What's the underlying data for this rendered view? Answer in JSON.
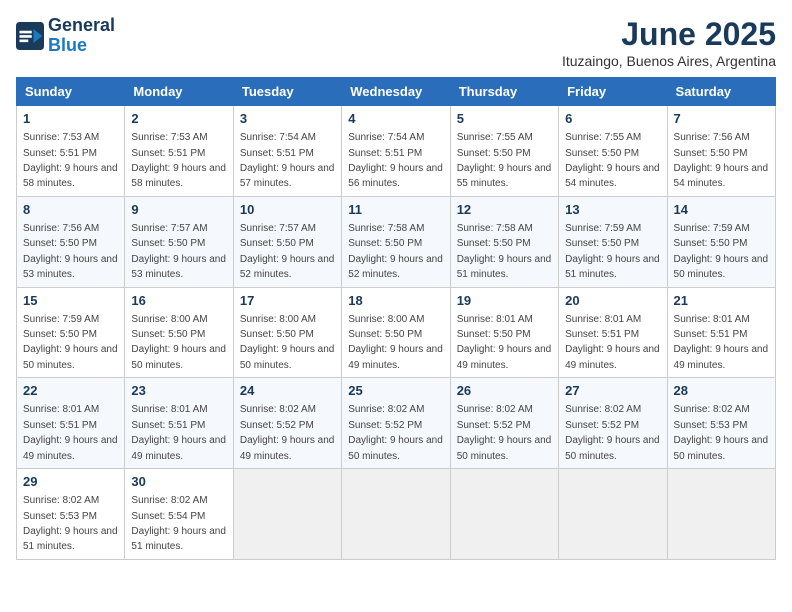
{
  "header": {
    "logo_line1": "General",
    "logo_line2": "Blue",
    "month": "June 2025",
    "location": "Ituzaingo, Buenos Aires, Argentina"
  },
  "weekdays": [
    "Sunday",
    "Monday",
    "Tuesday",
    "Wednesday",
    "Thursday",
    "Friday",
    "Saturday"
  ],
  "weeks": [
    [
      {
        "day": "1",
        "sunrise": "7:53 AM",
        "sunset": "5:51 PM",
        "daylight": "9 hours and 58 minutes."
      },
      {
        "day": "2",
        "sunrise": "7:53 AM",
        "sunset": "5:51 PM",
        "daylight": "9 hours and 58 minutes."
      },
      {
        "day": "3",
        "sunrise": "7:54 AM",
        "sunset": "5:51 PM",
        "daylight": "9 hours and 57 minutes."
      },
      {
        "day": "4",
        "sunrise": "7:54 AM",
        "sunset": "5:51 PM",
        "daylight": "9 hours and 56 minutes."
      },
      {
        "day": "5",
        "sunrise": "7:55 AM",
        "sunset": "5:50 PM",
        "daylight": "9 hours and 55 minutes."
      },
      {
        "day": "6",
        "sunrise": "7:55 AM",
        "sunset": "5:50 PM",
        "daylight": "9 hours and 54 minutes."
      },
      {
        "day": "7",
        "sunrise": "7:56 AM",
        "sunset": "5:50 PM",
        "daylight": "9 hours and 54 minutes."
      }
    ],
    [
      {
        "day": "8",
        "sunrise": "7:56 AM",
        "sunset": "5:50 PM",
        "daylight": "9 hours and 53 minutes."
      },
      {
        "day": "9",
        "sunrise": "7:57 AM",
        "sunset": "5:50 PM",
        "daylight": "9 hours and 53 minutes."
      },
      {
        "day": "10",
        "sunrise": "7:57 AM",
        "sunset": "5:50 PM",
        "daylight": "9 hours and 52 minutes."
      },
      {
        "day": "11",
        "sunrise": "7:58 AM",
        "sunset": "5:50 PM",
        "daylight": "9 hours and 52 minutes."
      },
      {
        "day": "12",
        "sunrise": "7:58 AM",
        "sunset": "5:50 PM",
        "daylight": "9 hours and 51 minutes."
      },
      {
        "day": "13",
        "sunrise": "7:59 AM",
        "sunset": "5:50 PM",
        "daylight": "9 hours and 51 minutes."
      },
      {
        "day": "14",
        "sunrise": "7:59 AM",
        "sunset": "5:50 PM",
        "daylight": "9 hours and 50 minutes."
      }
    ],
    [
      {
        "day": "15",
        "sunrise": "7:59 AM",
        "sunset": "5:50 PM",
        "daylight": "9 hours and 50 minutes."
      },
      {
        "day": "16",
        "sunrise": "8:00 AM",
        "sunset": "5:50 PM",
        "daylight": "9 hours and 50 minutes."
      },
      {
        "day": "17",
        "sunrise": "8:00 AM",
        "sunset": "5:50 PM",
        "daylight": "9 hours and 50 minutes."
      },
      {
        "day": "18",
        "sunrise": "8:00 AM",
        "sunset": "5:50 PM",
        "daylight": "9 hours and 49 minutes."
      },
      {
        "day": "19",
        "sunrise": "8:01 AM",
        "sunset": "5:50 PM",
        "daylight": "9 hours and 49 minutes."
      },
      {
        "day": "20",
        "sunrise": "8:01 AM",
        "sunset": "5:51 PM",
        "daylight": "9 hours and 49 minutes."
      },
      {
        "day": "21",
        "sunrise": "8:01 AM",
        "sunset": "5:51 PM",
        "daylight": "9 hours and 49 minutes."
      }
    ],
    [
      {
        "day": "22",
        "sunrise": "8:01 AM",
        "sunset": "5:51 PM",
        "daylight": "9 hours and 49 minutes."
      },
      {
        "day": "23",
        "sunrise": "8:01 AM",
        "sunset": "5:51 PM",
        "daylight": "9 hours and 49 minutes."
      },
      {
        "day": "24",
        "sunrise": "8:02 AM",
        "sunset": "5:52 PM",
        "daylight": "9 hours and 49 minutes."
      },
      {
        "day": "25",
        "sunrise": "8:02 AM",
        "sunset": "5:52 PM",
        "daylight": "9 hours and 50 minutes."
      },
      {
        "day": "26",
        "sunrise": "8:02 AM",
        "sunset": "5:52 PM",
        "daylight": "9 hours and 50 minutes."
      },
      {
        "day": "27",
        "sunrise": "8:02 AM",
        "sunset": "5:52 PM",
        "daylight": "9 hours and 50 minutes."
      },
      {
        "day": "28",
        "sunrise": "8:02 AM",
        "sunset": "5:53 PM",
        "daylight": "9 hours and 50 minutes."
      }
    ],
    [
      {
        "day": "29",
        "sunrise": "8:02 AM",
        "sunset": "5:53 PM",
        "daylight": "9 hours and 51 minutes."
      },
      {
        "day": "30",
        "sunrise": "8:02 AM",
        "sunset": "5:54 PM",
        "daylight": "9 hours and 51 minutes."
      },
      null,
      null,
      null,
      null,
      null
    ]
  ]
}
